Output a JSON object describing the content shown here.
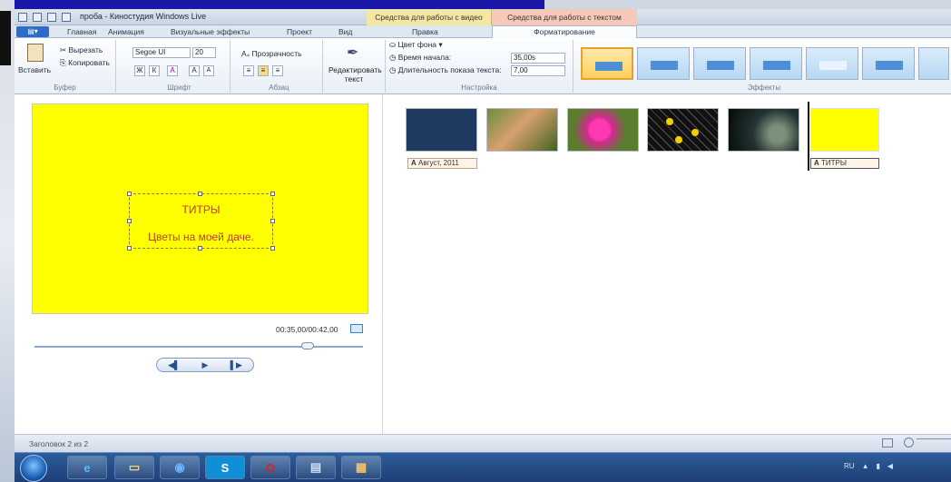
{
  "window": {
    "title": "проба - Киностудия Windows Live",
    "ctx_video": "Средства для работы с видео",
    "ctx_text": "Средства для работы с текстом"
  },
  "tabs": {
    "file": "",
    "items": [
      "Главная",
      "Анимация",
      "Визуальные эффекты",
      "Проект",
      "Вид",
      "Правка",
      "Форматирование"
    ]
  },
  "ribbon": {
    "clipboard": {
      "paste": "Вставить",
      "cut": "Вырезать",
      "copy": "Копировать",
      "group": "Буфер"
    },
    "font": {
      "family": "Segoe UI",
      "size": "20",
      "bold": "Ж",
      "italic": "К",
      "color": "А",
      "grow": "А",
      "shrink": "А",
      "group": "Шрифт"
    },
    "paragraph": {
      "transparency": "Прозрачность",
      "group": "Абзац"
    },
    "edit_text": "Редактировать текст",
    "settings": {
      "bg_color": "Цвет фона",
      "start_time": "Время начала:",
      "start_value": "35,00s",
      "duration": "Длительность показа текста:",
      "duration_value": "7,00",
      "group": "Настройка"
    },
    "effects_group": "Эффекты"
  },
  "preview": {
    "caption_line1": "ТИТРЫ",
    "caption_line2": "Цветы на моей даче.",
    "time": "00:35,00/00:42,00",
    "prev": "◀▌",
    "play": "▶",
    "next": "▌▶"
  },
  "storyboard": {
    "label1": "Август, 2011",
    "label2": "ТИТРЫ"
  },
  "status": {
    "text": "Заголовок 2 из 2"
  },
  "tray": {
    "lang": "RU"
  },
  "colors": {
    "preview_bg": "#ffff00",
    "caption_text": "#c0392b",
    "taskbar": "#1d3f75"
  }
}
